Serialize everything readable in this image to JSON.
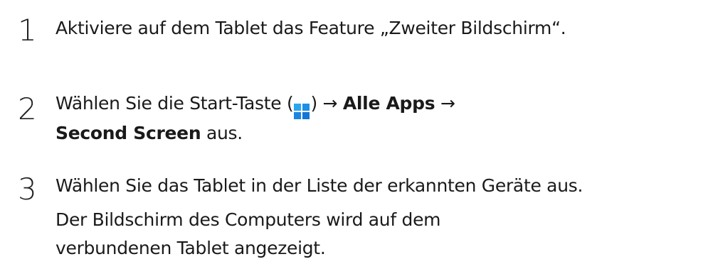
{
  "steps": [
    {
      "number": "1",
      "text": "Aktiviere auf dem Tablet das Feature „Zweiter Bildschirm“."
    },
    {
      "number": "2",
      "prefix": "Wählen Sie die Start-Taste (",
      "icon": "windows-start-icon",
      "after_icon": ") → ",
      "bold1": "Alle Apps",
      "arrow": " → ",
      "bold2": "Second Screen",
      "suffix": " aus."
    },
    {
      "number": "3",
      "text": "Wählen Sie das Tablet in der Liste der erkannten Geräte aus.",
      "note": "Der Bildschirm des Computers wird auf dem verbundenen Tablet angezeigt."
    }
  ],
  "colors": {
    "text": "#1a1a1a",
    "windows_icon": "#1f8ee8"
  }
}
